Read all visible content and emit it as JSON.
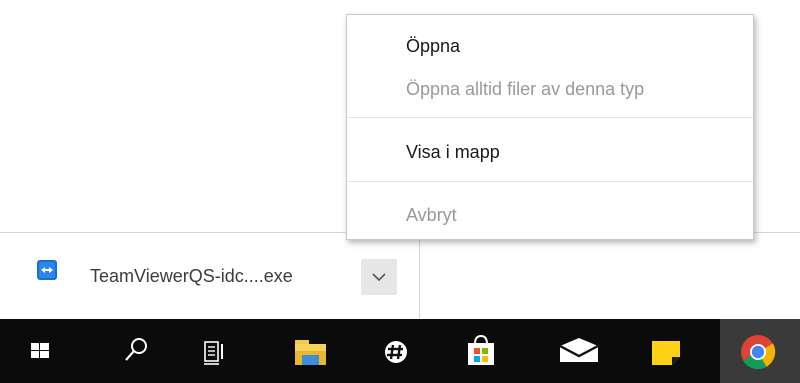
{
  "context_menu": {
    "items": [
      {
        "label": "Öppna",
        "enabled": true
      },
      {
        "label": "Öppna alltid filer av denna typ",
        "enabled": false
      },
      {
        "label": "Visa i mapp",
        "enabled": true
      },
      {
        "label": "Avbryt",
        "enabled": false
      }
    ]
  },
  "download_shelf": {
    "item": {
      "file_name": "TeamViewerQS-idc....exe",
      "icon": "teamviewer-icon",
      "menu_icon": "chevron-down-icon"
    }
  },
  "taskbar": {
    "items": [
      {
        "icon": "windows-start-icon"
      },
      {
        "icon": "search-icon"
      },
      {
        "icon": "task-view-icon"
      },
      {
        "icon": "file-explorer-icon"
      },
      {
        "icon": "slack-icon"
      },
      {
        "icon": "microsoft-store-icon"
      },
      {
        "icon": "mail-icon"
      },
      {
        "icon": "sticky-notes-icon"
      },
      {
        "icon": "chrome-icon",
        "active": true
      }
    ]
  },
  "colors": {
    "taskbar_bg": "#0b0b0b",
    "menu_text": "#1a1a1a",
    "menu_disabled_text": "#9a9a9a",
    "teamviewer_blue": "#1a6fd6"
  }
}
